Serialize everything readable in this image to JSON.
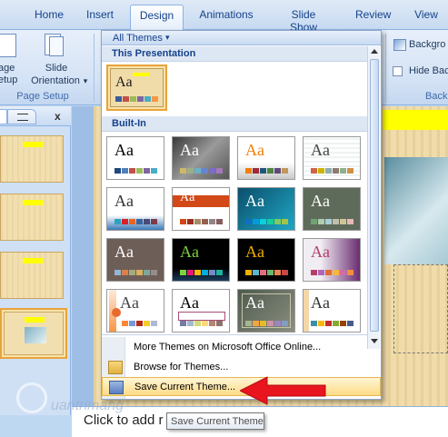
{
  "tabs": [
    "Home",
    "Insert",
    "Design",
    "Animations",
    "Slide Show",
    "Review",
    "View"
  ],
  "active_tab": "Design",
  "ribbon": {
    "page_setup_label": "Page Setup",
    "page_setup_button": "age\netup",
    "orientation_line1": "Slide",
    "orientation_line2": "Orientation",
    "orientation_arrow": "▾",
    "background_styles": "Backgro",
    "hide_background": "Hide Bac",
    "background_group": "Back"
  },
  "left_pane": {
    "close": "x"
  },
  "gallery": {
    "header": "All Themes",
    "header_arrow": "▾",
    "this_presentation": "This Presentation",
    "built_in": "Built-In",
    "aa": "Aa",
    "menu": {
      "more_themes": "More Themes on Microsoft Office Online...",
      "browse": "Browse for Themes...",
      "save_current": "Save Current Theme..."
    }
  },
  "notes_placeholder": "Click to add r",
  "tooltip": "Save Current Theme",
  "watermark": "uantrimang",
  "colors": {
    "arrow_red": "#e8141e",
    "selected_border": "#e8a33c",
    "ribbon_text": "#15428b"
  }
}
